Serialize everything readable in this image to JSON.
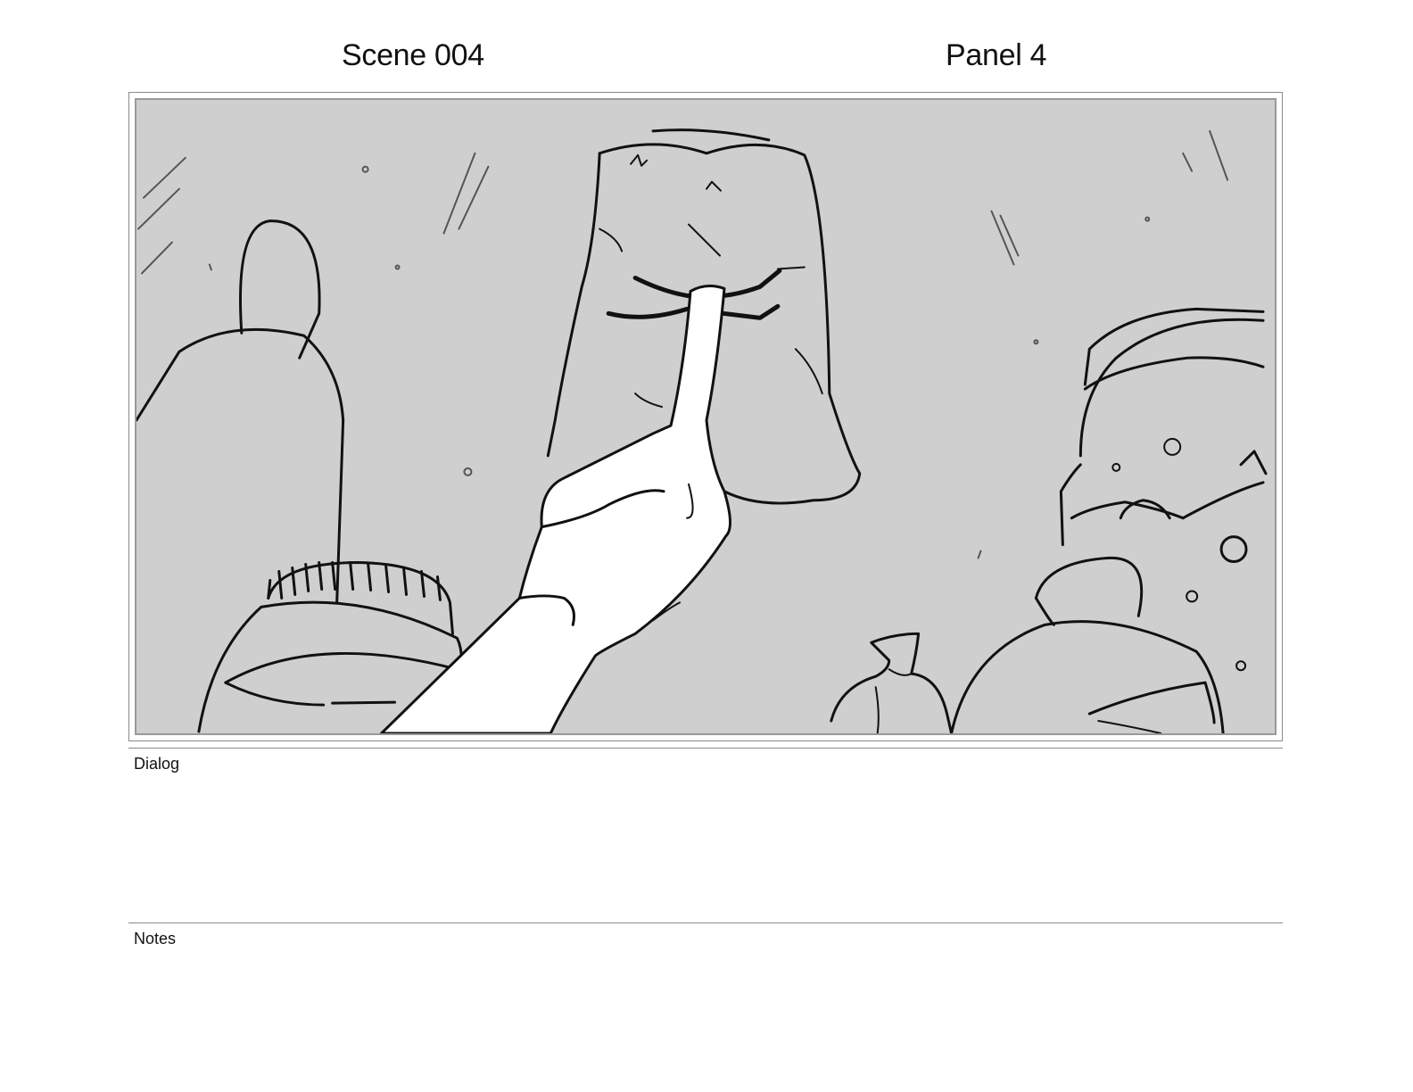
{
  "header": {
    "scene": "Scene 004",
    "panel": "Panel 4"
  },
  "sections": {
    "dialog_label": "Dialog",
    "dialog_text": "",
    "notes_label": "Notes",
    "notes_text": ""
  },
  "colors": {
    "sketch_background": "#cfcfcf",
    "ink": "#111111",
    "frame_border": "#8a8a8a"
  }
}
